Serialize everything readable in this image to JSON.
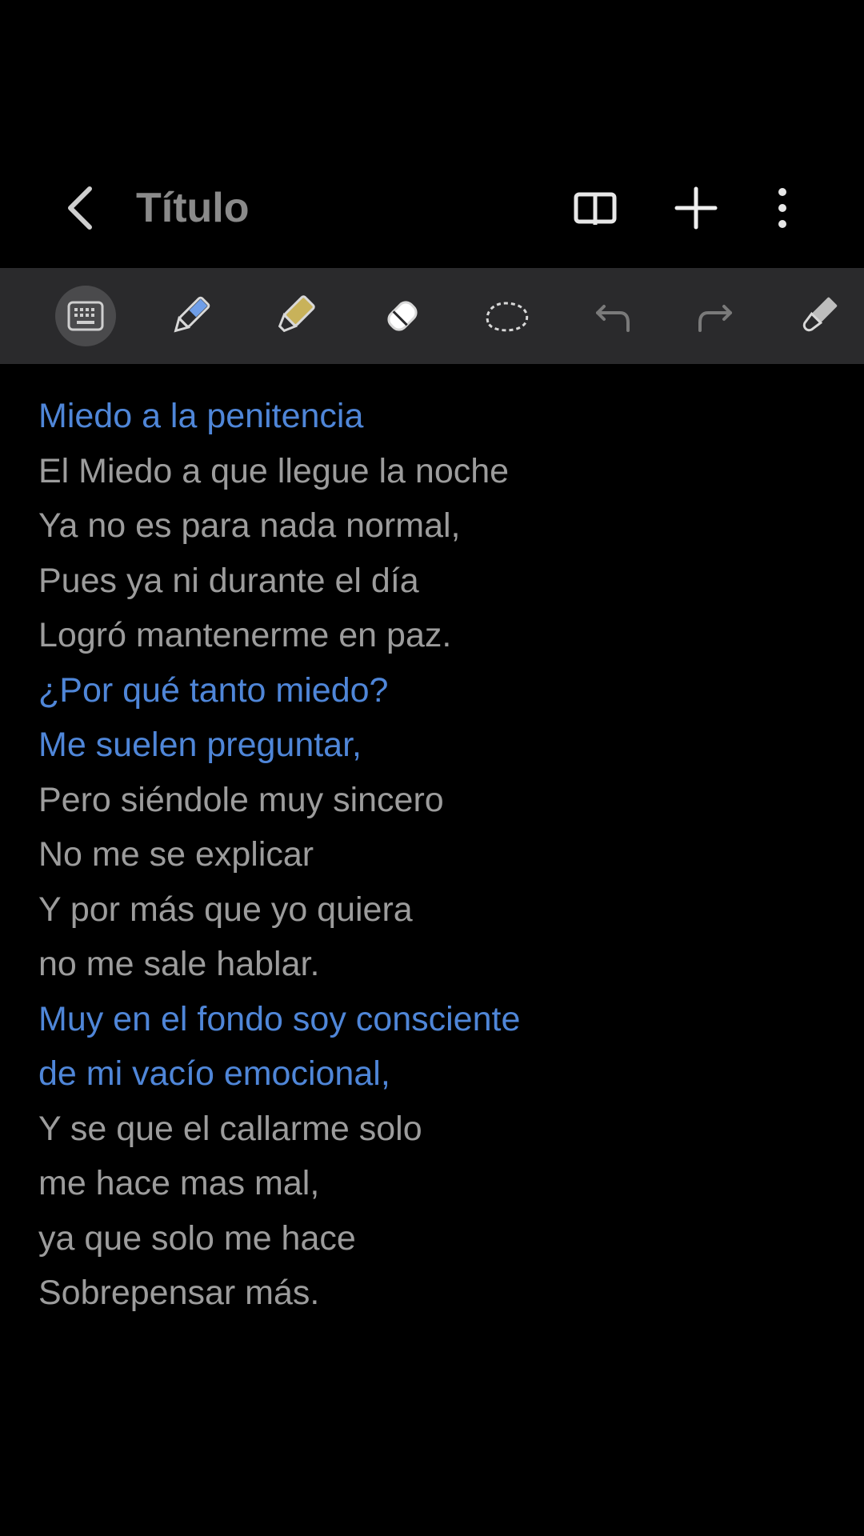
{
  "header": {
    "title": "Título"
  },
  "toolbar": {
    "tools": [
      {
        "name": "keyboard-icon",
        "active": true
      },
      {
        "name": "pen-icon",
        "active": false
      },
      {
        "name": "highlighter-icon",
        "active": false
      },
      {
        "name": "eraser-icon",
        "active": false
      },
      {
        "name": "lasso-icon",
        "active": false
      },
      {
        "name": "undo-icon",
        "active": false
      },
      {
        "name": "redo-icon",
        "active": false
      },
      {
        "name": "brush-icon",
        "active": false
      }
    ]
  },
  "note": {
    "lines": [
      {
        "text": "Miedo a la penitencia",
        "color": "blue"
      },
      {
        "text": "El Miedo a que llegue la noche",
        "color": "grey"
      },
      {
        "text": "Ya no es para nada normal,",
        "color": "grey"
      },
      {
        "text": "Pues ya ni durante el día",
        "color": "grey"
      },
      {
        "text": "Logró mantenerme en paz.",
        "color": "grey"
      },
      {
        "text": "¿Por qué tanto miedo?",
        "color": "blue"
      },
      {
        "text": "Me suelen preguntar,",
        "color": "blue"
      },
      {
        "text": "Pero siéndole muy sincero",
        "color": "grey"
      },
      {
        "text": "No me se explicar",
        "color": "grey"
      },
      {
        "text": "Y por más que yo quiera",
        "color": "grey"
      },
      {
        "text": "no me sale hablar.",
        "color": "grey"
      },
      {
        "text": "Muy en el fondo soy consciente",
        "color": "blue"
      },
      {
        "text": "de mi vacío emocional,",
        "color": "blue"
      },
      {
        "text": "Y se que el callarme solo",
        "color": "grey"
      },
      {
        "text": "me hace mas mal,",
        "color": "grey"
      },
      {
        "text": "ya que solo me hace",
        "color": "grey"
      },
      {
        "text": "Sobrepensar más.",
        "color": "grey"
      }
    ]
  },
  "colors": {
    "background": "#000000",
    "toolbar": "#2a2a2c",
    "accent_blue": "#4f86d8",
    "text_grey": "#9c9c9c",
    "pen_blue": "#6f9ee8",
    "highlighter_yellow": "#c8b25a"
  }
}
